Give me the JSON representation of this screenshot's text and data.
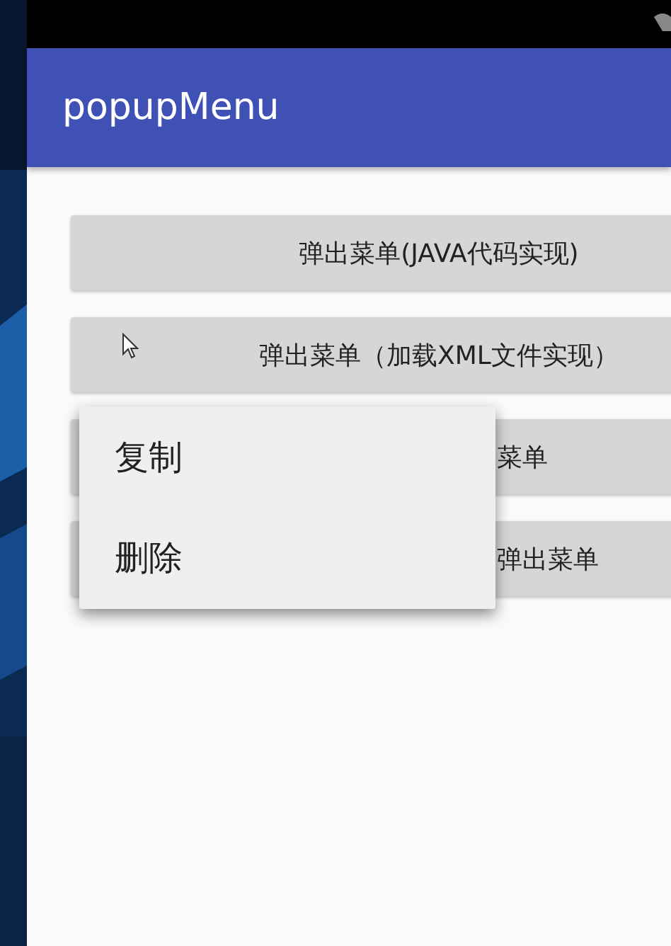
{
  "app_bar": {
    "title": "popupMenu"
  },
  "buttons": [
    {
      "kind": "full",
      "label": "弹出菜单(JAVA代码实现)"
    },
    {
      "kind": "full",
      "label": "弹出菜单（加载XML文件实现）"
    },
    {
      "kind": "covered",
      "label": "菜单"
    },
    {
      "kind": "covered",
      "label": "弹出菜单"
    }
  ],
  "popup_menu": {
    "items": [
      {
        "label": "复制"
      },
      {
        "label": "删除"
      }
    ]
  }
}
